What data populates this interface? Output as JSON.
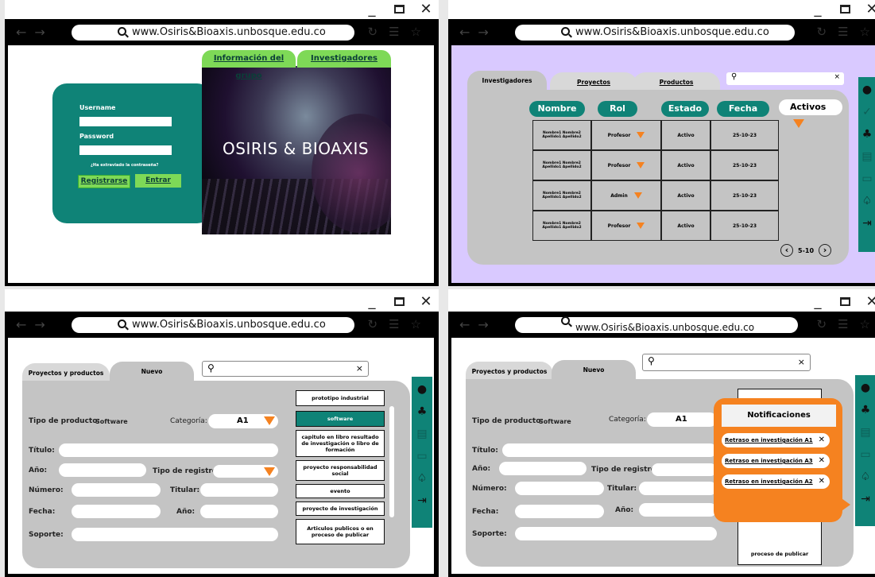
{
  "browser": {
    "url": "www.Osiris&Bioaxis.unbosque.edu.co",
    "min": "_",
    "close": "✕"
  },
  "login": {
    "tab_group_info": "Información del grupo",
    "tab_researchers": "Investigadores",
    "username_label": "Username",
    "password_label": "Password",
    "forgot": "¿Ha extraviado la contraseña?",
    "register": "Registrarse",
    "enter": "Entrar",
    "brand": "OSIRIS & BIOAXIS"
  },
  "researchers": {
    "tabs": [
      "Investigadores",
      "Proyectos",
      "Productos"
    ],
    "search_close": "×",
    "headers": [
      "Nombre",
      "Rol",
      "Estado",
      "Fecha"
    ],
    "filter": "Activos",
    "rows": [
      {
        "name": "Nombre1 Nombre2 Apellido1 Apellido2",
        "role": "Profesor",
        "state": "Activo",
        "date": "25-10-23"
      },
      {
        "name": "Nombre1 Nombre2 Apellido1 Apellido2",
        "role": "Profesor",
        "state": "Activo",
        "date": "25-10-23"
      },
      {
        "name": "Nombre1 Nombre2 Apellido1 Apellido2",
        "role": "Admin",
        "state": "Activo",
        "date": "25-10-23"
      },
      {
        "name": "Nombre1 Nombre2 Apellido1 Apellido2",
        "role": "Profesor",
        "state": "Activo",
        "date": "25-10-23"
      }
    ],
    "pagination": "5-10"
  },
  "new_product": {
    "tabs": [
      "Proyectos y productos",
      "Nuevo"
    ],
    "search_close": "×",
    "tipo_label": "Tipo de producto:",
    "tipo_value": "Software",
    "categoria_label": "Categoría:",
    "categoria_value": "A1",
    "titulo": "Título:",
    "anio": "Año:",
    "tipo_registro": "Tipo de registro:",
    "numero": "Número:",
    "titular": "Titular:",
    "fecha": "Fecha:",
    "anio2": "Año:",
    "soporte": "Soporte:",
    "options": [
      "prototipo industrial",
      "software",
      "capitulo en libro resultado de investigación o libro de formación",
      "proyecto responsabilidad social",
      "evento",
      "proyecto de investigación",
      "Articulos publicos o en proceso de publicar"
    ],
    "selected_option_index": 1
  },
  "notifications": {
    "title": "Notificaciones",
    "items": [
      "Retraso en investigación A1",
      "Retraso en investigación A3",
      "Retraso en investigación A2"
    ],
    "behind_option": "proceso de publicar"
  },
  "colors": {
    "teal": "#0f8377",
    "green": "#7ed957",
    "orange": "#f58220",
    "lavender": "#d9c9ff",
    "gray": "#c4c4c4"
  }
}
